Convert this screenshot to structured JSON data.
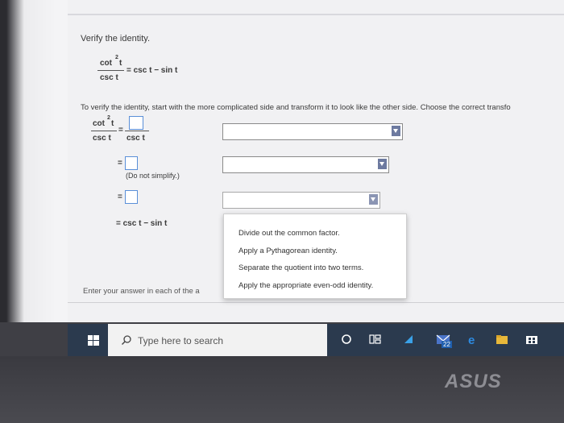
{
  "question": {
    "header": "Verify the identity.",
    "identity": {
      "numerator": "cot",
      "exponent": "2",
      "var": "t",
      "denominator": "csc t",
      "rhs": "= csc t − sin t"
    },
    "instruction": "To verify the identity, start with the more complicated side and transform it to look like the other side. Choose the correct transfo",
    "steps": [
      {
        "lhs_num": "cot",
        "lhs_exp": "2",
        "lhs_var": "t",
        "lhs_den": "csc t",
        "eq": "=",
        "rhs_den": "csc t"
      },
      {
        "eq": "=",
        "note": "(Do not simplify.)"
      },
      {
        "eq": "="
      },
      {
        "final": "= csc t − sin t"
      }
    ],
    "footer": "Enter your answer in each of the a"
  },
  "dropdown": {
    "options": [
      "Divide out the common factor.",
      "Apply a Pythagorean identity.",
      "Separate the quotient into two terms.",
      "Apply the appropriate even-odd identity."
    ]
  },
  "taskbar": {
    "search_placeholder": "Type here to search",
    "badge": "22"
  },
  "bezel": {
    "brand": "ASUS"
  }
}
